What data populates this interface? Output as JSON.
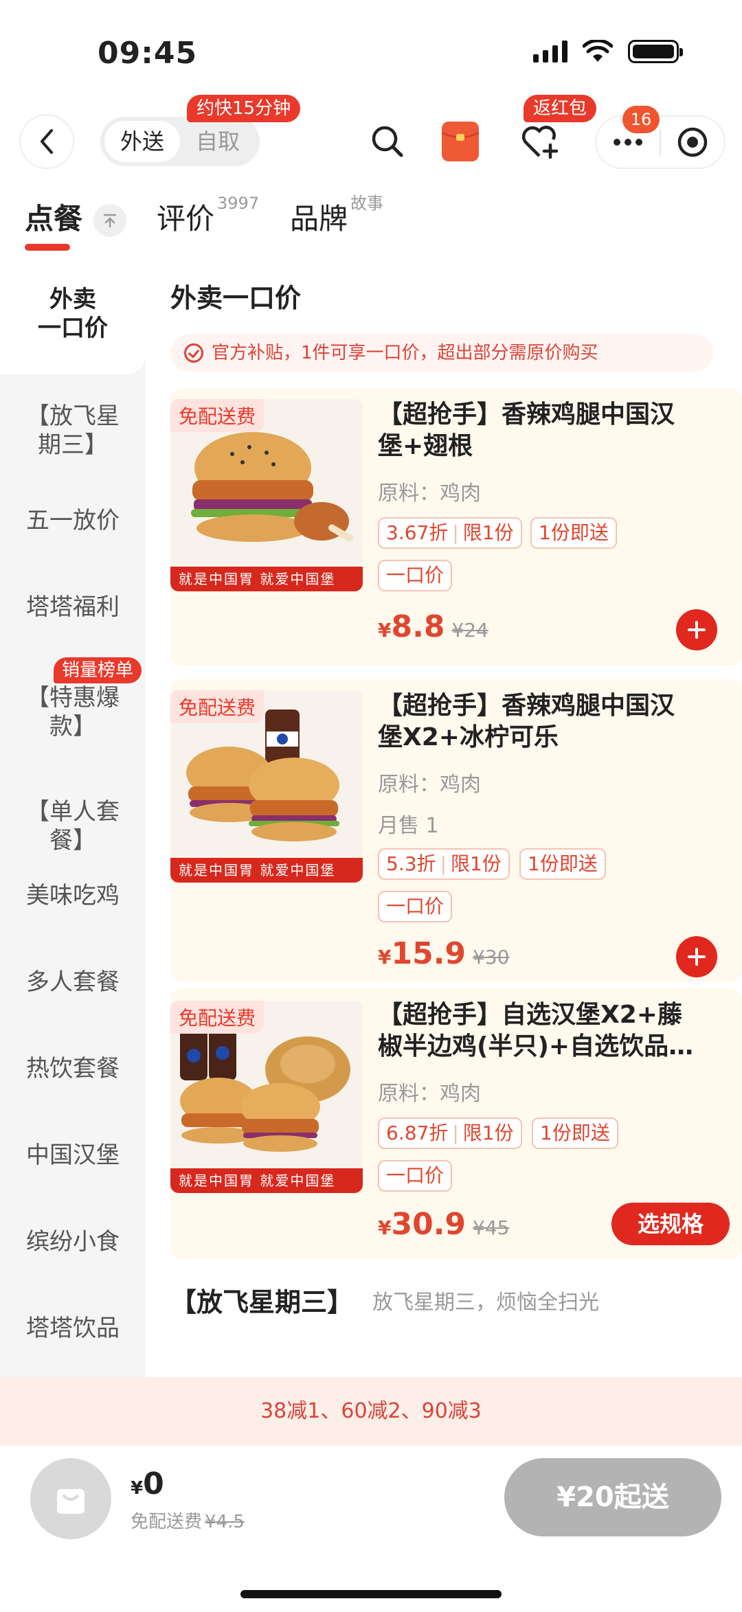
{
  "status_bar": {
    "time": "09:45"
  },
  "nav": {
    "delivery_tab": "外送",
    "pickup_tab": "自取",
    "speed_badge": "约快15分钟",
    "redpacket_badge": "返红包",
    "message_count": "16"
  },
  "tabs": [
    {
      "label": "点餐",
      "sup": ""
    },
    {
      "label": "评价",
      "sup": "3997"
    },
    {
      "label": "品牌",
      "sup": "故事"
    }
  ],
  "sidebar": {
    "items": [
      {
        "label_lines": [
          "外卖",
          "一口价"
        ],
        "active": true
      },
      {
        "label_lines": [
          "【放飞星",
          "期三】"
        ]
      },
      {
        "label_lines": [
          "五一放价"
        ]
      },
      {
        "label_lines": [
          "塔塔福利"
        ]
      },
      {
        "label_lines": [
          "【特惠爆",
          "款】"
        ],
        "tag": "销量榜单"
      },
      {
        "label_lines": [
          "【单人套",
          "餐】"
        ]
      },
      {
        "label_lines": [
          "美味吃鸡"
        ]
      },
      {
        "label_lines": [
          "多人套餐"
        ]
      },
      {
        "label_lines": [
          "热饮套餐"
        ]
      },
      {
        "label_lines": [
          "中国汉堡"
        ]
      },
      {
        "label_lines": [
          "缤纷小食"
        ]
      },
      {
        "label_lines": [
          "塔塔饮品"
        ]
      }
    ]
  },
  "main": {
    "section_title": "外卖一口价",
    "subsidy_note": "官方补贴，1件可享一口价，超出部分需原价购买",
    "products": [
      {
        "free_ship": "免配送费",
        "slogan": "就是中国胃 就爱中国堡",
        "title_line1": "【超抢手】香辣鸡腿中国汉",
        "title_line2": "堡+翅根",
        "material": "原料：鸡肉",
        "monthly": "",
        "discount": "3.67折",
        "limit": "限1份",
        "instant": "1份即送",
        "fixed_price_tag": "一口价",
        "currency": "¥",
        "price": "8.8",
        "original_price": "¥24",
        "action": "add"
      },
      {
        "free_ship": "免配送费",
        "slogan": "就是中国胃 就爱中国堡",
        "title_line1": "【超抢手】香辣鸡腿中国汉",
        "title_line2": "堡X2+冰柠可乐",
        "material": "原料：鸡肉",
        "monthly": "月售 1",
        "discount": "5.3折",
        "limit": "限1份",
        "instant": "1份即送",
        "fixed_price_tag": "一口价",
        "currency": "¥",
        "price": "15.9",
        "original_price": "¥30",
        "action": "add"
      },
      {
        "free_ship": "免配送费",
        "slogan": "就是中国胃 就爱中国堡",
        "title_line1": "【超抢手】自选汉堡X2+藤",
        "title_line2": "椒半边鸡(半只)+自选饮品…",
        "material": "原料：鸡肉",
        "monthly": "",
        "discount": "6.87折",
        "limit": "限1份",
        "instant": "1份即送",
        "fixed_price_tag": "一口价",
        "currency": "¥",
        "price": "30.9",
        "original_price": "¥45",
        "action": "选规格"
      }
    ],
    "next_section_title": "【放飞星期三】",
    "next_section_sub": "放飞星期三，烦恼全扫光"
  },
  "promo_bar": "38减1、60减2、90减3",
  "cart": {
    "currency": "¥",
    "total": "0",
    "fee_label": "免配送费",
    "fee_original": "¥4.5",
    "checkout_label": "¥20起送"
  },
  "colors": {
    "accent": "#e8392b",
    "card_bg": "#fff9ee",
    "sidebar_bg": "#f5f5f5",
    "promo_bg": "#fdeee8",
    "checkout_disabled": "#b3b3b3"
  }
}
